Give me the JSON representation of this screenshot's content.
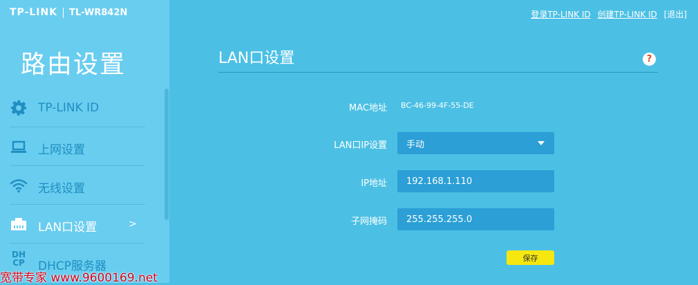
{
  "header": {
    "brand": "TP-LINK",
    "model": "TL-WR842N",
    "links": {
      "login": "登录TP-LINK ID",
      "create": "创建TP-LINK ID",
      "logout": "[退出]"
    }
  },
  "sidebar": {
    "title": "路由设置",
    "items": [
      {
        "label": "TP-LINK ID",
        "icon": "gear-icon"
      },
      {
        "label": "上网设置",
        "icon": "laptop-icon"
      },
      {
        "label": "无线设置",
        "icon": "wifi-icon"
      },
      {
        "label": "LAN口设置",
        "icon": "lan-port-icon",
        "arrow": ">"
      },
      {
        "label": "DHCP服务器",
        "icon": "dhcp-icon",
        "icon_text": "DH\nCP"
      }
    ]
  },
  "main": {
    "title": "LAN口设置",
    "help": "?",
    "mac": {
      "label": "MAC地址",
      "value": "BC-46-99-4F-55-DE"
    },
    "lan_ip_setting": {
      "label": "LAN口IP设置",
      "value": "手动"
    },
    "ip": {
      "label": "IP地址",
      "value": "192.168.1.110"
    },
    "subnet": {
      "label": "子网掩码",
      "value": "255.255.255.0"
    },
    "save_label": "保存"
  },
  "watermark": "宽带专家 www.9600169.net",
  "colors": {
    "background": "#4cc0e4",
    "sidebar": "#69cdef",
    "field": "#2b9fd6",
    "save_button": "#f5e70f",
    "help_mark": "#e0491e",
    "nav_text": "#1f8ec2"
  }
}
